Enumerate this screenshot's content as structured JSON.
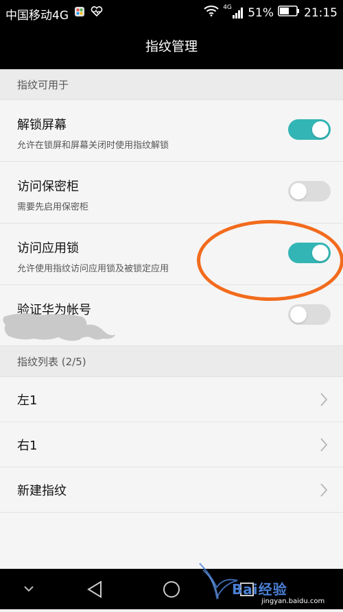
{
  "status_bar": {
    "carrier": "中国移动4G",
    "network": "4G",
    "battery": "51%",
    "time": "21:15"
  },
  "header": {
    "title": "指纹管理"
  },
  "sections": [
    {
      "label": "指纹可用于"
    },
    {
      "label": "指纹列表 (2/5)"
    }
  ],
  "toggles": [
    {
      "title": "解锁屏幕",
      "subtitle": "允许在锁屏和屏幕关闭时使用指纹解锁",
      "state": "on"
    },
    {
      "title": "访问保密柜",
      "subtitle": "需要先启用保密柜",
      "state": "off"
    },
    {
      "title": "访问应用锁",
      "subtitle": "允许使用指纹访问应用锁及被锁定应用",
      "state": "on"
    },
    {
      "title": "验证华为帐号",
      "subtitle": "",
      "state": "off"
    }
  ],
  "fingerprints": [
    {
      "label": "左1"
    },
    {
      "label": "右1"
    },
    {
      "label": "新建指纹"
    }
  ],
  "watermark": {
    "text": "Bai经验",
    "url": "jingyan.baidu.com"
  },
  "colors": {
    "toggle_on": "#33b5b5",
    "toggle_off": "#dcdcdc",
    "annotation": "#f26b1d",
    "bar_background": "#000000"
  },
  "icons": {
    "wifi": "wifi-icon",
    "signal": "signal-icon",
    "battery": "battery-icon",
    "back": "back-triangle-icon",
    "home": "home-circle-icon",
    "recent": "recent-square-icon",
    "collapse": "chevron-down-icon"
  }
}
